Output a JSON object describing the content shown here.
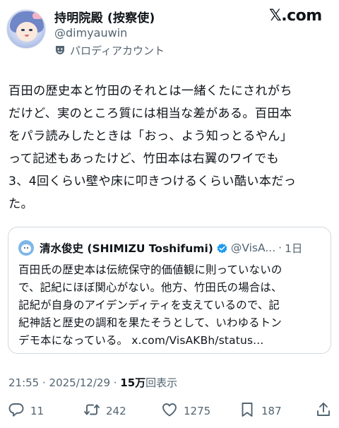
{
  "author": {
    "display_name": "持明院殿 (按察使)",
    "handle": "@dimyauwin",
    "parody_label": "パロディアカウント",
    "avatar_icon": "anime-character-avatar",
    "parody_icon": "theater-mask-icon"
  },
  "brand": {
    "logo_text": "𝕏.com"
  },
  "post": {
    "lines": [
      "百田の歴史本と竹田のそれとは一緒くたにされがち",
      "だけど、実のところ質には相当な差がある。百田本",
      "をパラ読みしたときは「おっ、よう知っとるやん」",
      "って記述もあったけど、竹田本は右翼のワイでも",
      "3、4回くらい壁や床に叩きつけるくらい酷い本だっ",
      "た。"
    ]
  },
  "quote": {
    "name": "清水俊史 (SHIMIZU Toshifumi)",
    "handle": "@VisA...",
    "dot": "·",
    "time": "1日",
    "verified_icon": "verified-badge-icon",
    "lines": [
      "百田氏の歴史本は伝統保守的価値観に則っていないの",
      "で、記紀にほぼ関心がない。他方、竹田氏の場合は、",
      "記紀が自身のアイデンディティを支えているので、記",
      "紀神話と歴史の調和を果たそうとして、いわゆるトン",
      "デモ本になっている。 x.com/VisAKBh/status..."
    ]
  },
  "meta": {
    "timestamp": "21:55 · 2025/12/29 · ",
    "views_count": "15万",
    "views_label": "回表示"
  },
  "actions": {
    "reply_count": "11",
    "repost_count": "242",
    "like_count": "1275",
    "bookmark_count": "187"
  },
  "colors": {
    "text": "#0f1419",
    "secondary": "#536471",
    "border": "#cfd9de",
    "verified": "#1d9bf0"
  }
}
